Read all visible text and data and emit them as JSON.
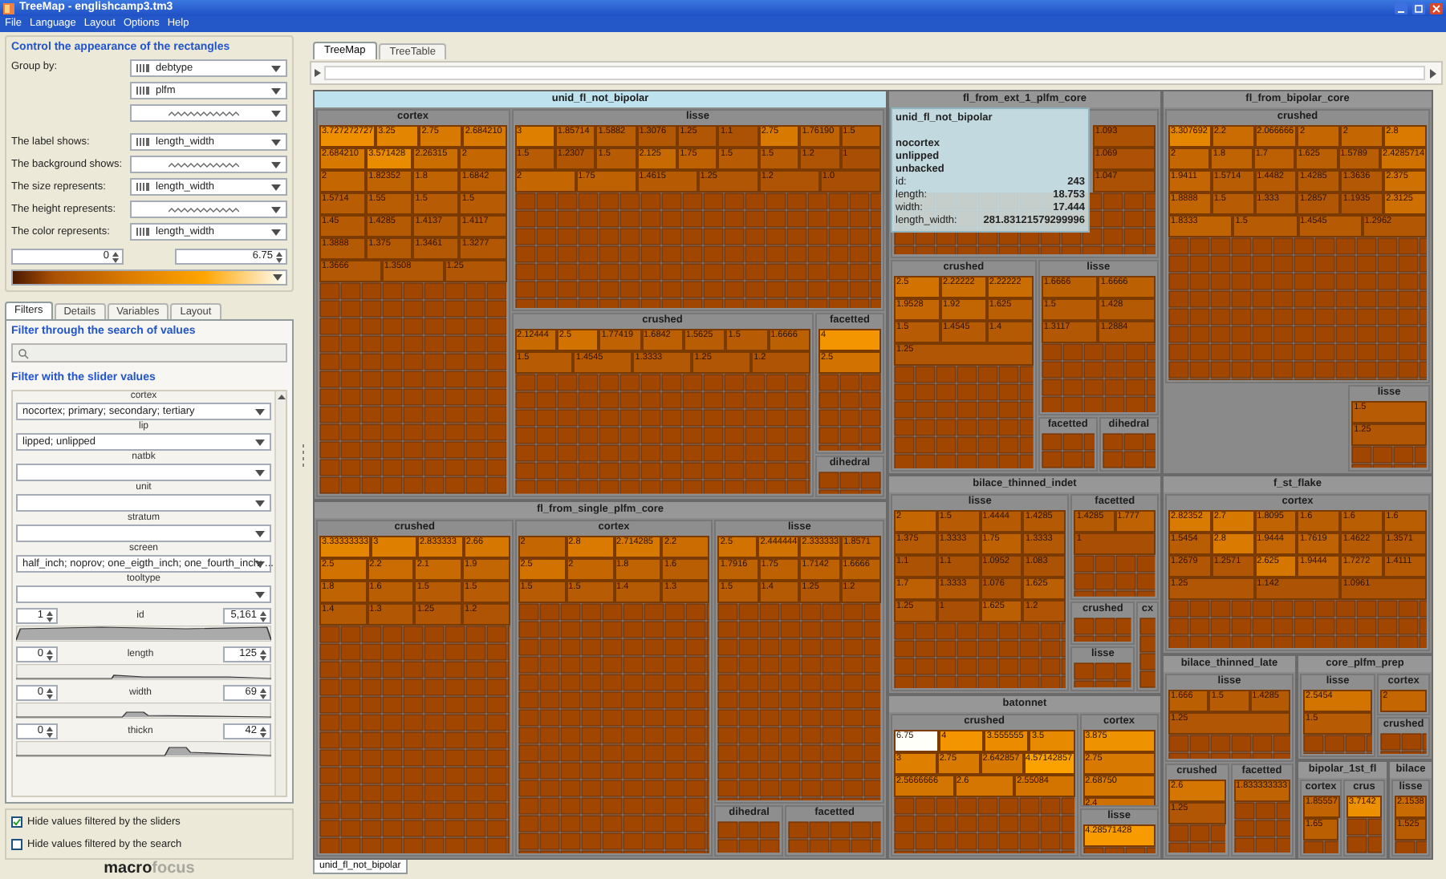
{
  "window": {
    "title": "TreeMap - englishcamp3.tm3"
  },
  "menu": [
    "File",
    "Language",
    "Layout",
    "Options",
    "Help"
  ],
  "appearance": {
    "title": "Control the appearance of the rectangles",
    "group_by_label": "Group by:",
    "group_by": [
      {
        "kind": "variable",
        "value": "debtype"
      },
      {
        "kind": "variable",
        "value": "plfm"
      },
      {
        "kind": "none"
      }
    ],
    "rows": [
      {
        "label": "The label shows:",
        "kind": "variable",
        "value": "length_width"
      },
      {
        "label": "The background shows:",
        "kind": "none"
      },
      {
        "label": "The size represents:",
        "kind": "variable",
        "value": "length_width"
      },
      {
        "label": "The height represents:",
        "kind": "none"
      },
      {
        "label": "The color represents:",
        "kind": "variable",
        "value": "length_width"
      }
    ],
    "range_min": "0",
    "range_max": "6.75"
  },
  "panel_tabs": [
    {
      "label": "Filters",
      "selected": true
    },
    {
      "label": "Details",
      "selected": false
    },
    {
      "label": "Variables",
      "selected": false
    },
    {
      "label": "Layout",
      "selected": false
    }
  ],
  "search_filter": {
    "title": "Filter through the search of values"
  },
  "slider_filter": {
    "title": "Filter with the slider values",
    "categorical": [
      {
        "name": "cortex",
        "value": "nocortex; primary; secondary; tertiary"
      },
      {
        "name": "lip",
        "value": "lipped; unlipped"
      },
      {
        "name": "natbk"
      },
      {
        "name": "unit"
      },
      {
        "name": "stratum"
      },
      {
        "name": "screen",
        "value": "half_inch; noprov; one_eigth_inch; one_fourth_inch; ..."
      },
      {
        "name": "tooltype"
      }
    ],
    "ranges": [
      {
        "name": "id",
        "min": "1",
        "max": "5,161"
      },
      {
        "name": "length",
        "min": "0",
        "max": "125"
      },
      {
        "name": "width",
        "min": "0",
        "max": "69"
      },
      {
        "name": "thickn",
        "min": "0",
        "max": "42"
      }
    ]
  },
  "checkboxes": [
    {
      "label": "Hide values filtered by the sliders",
      "checked": true
    },
    {
      "label": "Hide values filtered by the search",
      "checked": false
    }
  ],
  "logo": {
    "part_1": "macro",
    "part_2": "focus"
  },
  "view_tabs": [
    {
      "label": "TreeMap",
      "selected": true
    },
    {
      "label": "TreeTable",
      "selected": false
    }
  ],
  "treemap": {
    "groups": [
      {
        "name": "unid_fl_not_bipolar",
        "highlighted": true,
        "subgroups": [
          {
            "name": "cortex",
            "cells": [
              "3.727272727",
              "3.25",
              "2.75",
              "2.684210",
              "2.684210",
              "3.571428",
              "2.26315",
              "2",
              "2",
              "1.82352",
              "1.8",
              "1.6842",
              "1.5714",
              "1.55",
              "1.5",
              "1.5",
              "1.45",
              "1.4285",
              "1.4137",
              "1.4117",
              "1.3888",
              "1.375",
              "1.3461",
              "1.3277",
              "1.3666",
              "1.3508",
              "1.25"
            ]
          },
          {
            "name": "lisse",
            "cells": [
              "3",
              "1.85714",
              "1.5882",
              "1.3076",
              "1.25",
              "1.1",
              "2.75",
              "1.76190",
              "1.5",
              "1.5",
              "1.2307",
              "1.5",
              "2.125",
              "1.75",
              "1.5",
              "1.5",
              "1.2",
              "1",
              "2",
              "1.75",
              "1.4615",
              "1.25",
              "1.2",
              "1.0"
            ]
          },
          {
            "name": "crushed",
            "cells": [
              "2.12444",
              "2.5",
              "1.77419",
              "1.6842",
              "1.5625",
              "1.5",
              "1.6666",
              "1.5",
              "1.4545",
              "1.3333",
              "1.25",
              "1.2"
            ]
          },
          {
            "name": "facetted",
            "cells": [
              "4",
              "2.5"
            ]
          },
          {
            "name": "dihedral"
          }
        ]
      },
      {
        "name": "fl_from_ext_1_plfm_core",
        "highlighted": false,
        "subgroups": [
          {
            "cells": [
              "1.093",
              "1.069",
              "1.047"
            ]
          },
          {
            "name": "crushed",
            "cells": [
              "2.5",
              "2.22222",
              "2.22222",
              "1.9528",
              "1.92",
              "1.625",
              "1.5",
              "1.4545",
              "1.4",
              "1.25"
            ]
          },
          {
            "name": "lisse",
            "cells": [
              "1.6666",
              "1.6666",
              "1.5",
              "1.428",
              "1.3117",
              "1.2884"
            ]
          },
          {
            "name": "facetted"
          },
          {
            "name": "dihedral"
          }
        ]
      },
      {
        "name": "fl_from_bipolar_core",
        "highlighted": false,
        "subgroups": [
          {
            "name": "crushed",
            "cells": [
              "3.307692",
              "2.2",
              "2.066666",
              "2",
              "2",
              "2.8",
              "2",
              "1.8",
              "1.7",
              "1.625",
              "1.5789",
              "2.4285714",
              "1.9411",
              "1.5714",
              "1.4482",
              "1.4285",
              "1.3636",
              "2.375",
              "1.8888",
              "1.5",
              "1.333",
              "1.2857",
              "1.1935",
              "2.3125",
              "1.8333",
              "1.5",
              "1.4545",
              "1.2962"
            ]
          },
          {
            "name": "lisse",
            "cells": [
              "1.5",
              "1.25"
            ]
          }
        ]
      },
      {
        "name": "fl_from_single_plfm_core",
        "highlighted": false,
        "subgroups": [
          {
            "name": "crushed",
            "cells": [
              "3.33333333",
              "3",
              "2.833333",
              "2.66",
              "2.5",
              "2.2",
              "2.1",
              "1.9",
              "1.8",
              "1.6",
              "1.5",
              "1.5",
              "1.4",
              "1.3",
              "1.25",
              "1.2"
            ]
          },
          {
            "name": "cortex",
            "cells": [
              "2",
              "2.8",
              "2.714285",
              "2.2",
              "2.5",
              "2",
              "1.8",
              "1.6",
              "1.5",
              "1.5",
              "1.4",
              "1.3"
            ]
          },
          {
            "name": "lisse",
            "cells": [
              "2.5",
              "2.444444",
              "2.333333",
              "1.8571",
              "1.7916",
              "1.75",
              "1.7142",
              "1.6666",
              "1.5",
              "1.4",
              "1.25",
              "1.2"
            ]
          },
          {
            "name": "dihedral"
          },
          {
            "name": "facetted"
          }
        ]
      },
      {
        "name": "bilace_thinned_indet",
        "highlighted": false,
        "subgroups": [
          {
            "name": "lisse",
            "cells": [
              "2",
              "1.5",
              "1.4444",
              "1.4285",
              "1.375",
              "1.3333",
              "1.75",
              "1.3333",
              "1.1",
              "1.1",
              "1.0952",
              "1.083",
              "1.7",
              "1.3333",
              "1.076",
              "1.625",
              "1.25",
              "1",
              "1.625",
              "1.2"
            ]
          },
          {
            "name": "facetted",
            "cells": [
              "1.4285",
              "1.777",
              "1"
            ]
          },
          {
            "name": "crushed"
          },
          {
            "name": "cx"
          },
          {
            "name": "lisse"
          }
        ]
      },
      {
        "name": "f_st_flake",
        "highlighted": false,
        "subgroups": [
          {
            "name": "cortex",
            "cells": [
              "2.82352",
              "2.7",
              "1.8095",
              "1.6",
              "1.6",
              "1.6",
              "1.5454",
              "2.8",
              "1.9444",
              "1.7619",
              "1.4622",
              "1.3571",
              "1.2679",
              "1.2571",
              "2.625",
              "1.9444",
              "1.7272",
              "1.4111",
              "1.25",
              "1.142",
              "1.0961"
            ]
          }
        ]
      },
      {
        "name": "batonnet",
        "highlighted": false,
        "subgroups": [
          {
            "name": "crushed",
            "cells": [
              "6.75",
              "4",
              "3.555555",
              "3.5",
              "3",
              "2.75",
              "2.642857",
              "4.57142857",
              "2.5666666",
              "2.6",
              "2.55084"
            ]
          },
          {
            "name": "cortex",
            "cells": [
              "3.875",
              "2.75",
              "2.68750",
              "2.4"
            ]
          },
          {
            "name": "lisse",
            "cells": [
              "4.28571428"
            ]
          }
        ]
      },
      {
        "name": "bilace_thinned_late",
        "highlighted": false,
        "subgroups": [
          {
            "name": "lisse",
            "cells": [
              "1.666",
              "1.5",
              "1.4285",
              "1.25"
            ]
          },
          {
            "name": "crushed",
            "cells": [
              "2.6",
              "1.25"
            ]
          },
          {
            "name": "facetted",
            "cells": [
              "1.833333333"
            ]
          }
        ]
      },
      {
        "name": "core_plfm_prep",
        "highlighted": false,
        "subgroups": [
          {
            "name": "lisse",
            "cells": [
              "2.5454",
              "1.5"
            ]
          },
          {
            "name": "cortex",
            "cells": [
              "2"
            ]
          },
          {
            "name": "crushed"
          }
        ]
      },
      {
        "name": "bipolar_1st_fl",
        "highlighted": false,
        "subgroups": [
          {
            "name": "cortex",
            "cells": [
              "1.85557",
              "1.65"
            ]
          },
          {
            "name": "crus",
            "cells": [
              "3.7142"
            ]
          }
        ]
      },
      {
        "name": "bilace",
        "highlighted": false,
        "subgroups": [
          {
            "name": "lisse",
            "cells": [
              "2.1538",
              "1.525"
            ]
          }
        ]
      }
    ],
    "tooltip": {
      "title": "unid_fl_not_bipolar",
      "lines": [
        "nocortex",
        "unlipped",
        "unbacked"
      ],
      "fields": [
        {
          "label": "id:",
          "value": "243"
        },
        {
          "label": "length:",
          "value": "18.753"
        },
        {
          "label": "width:",
          "value": "17.444"
        },
        {
          "label": "length_width:",
          "value": "281.83121579299996"
        }
      ]
    }
  },
  "bottom_tab": "unid_fl_not_bipolar"
}
